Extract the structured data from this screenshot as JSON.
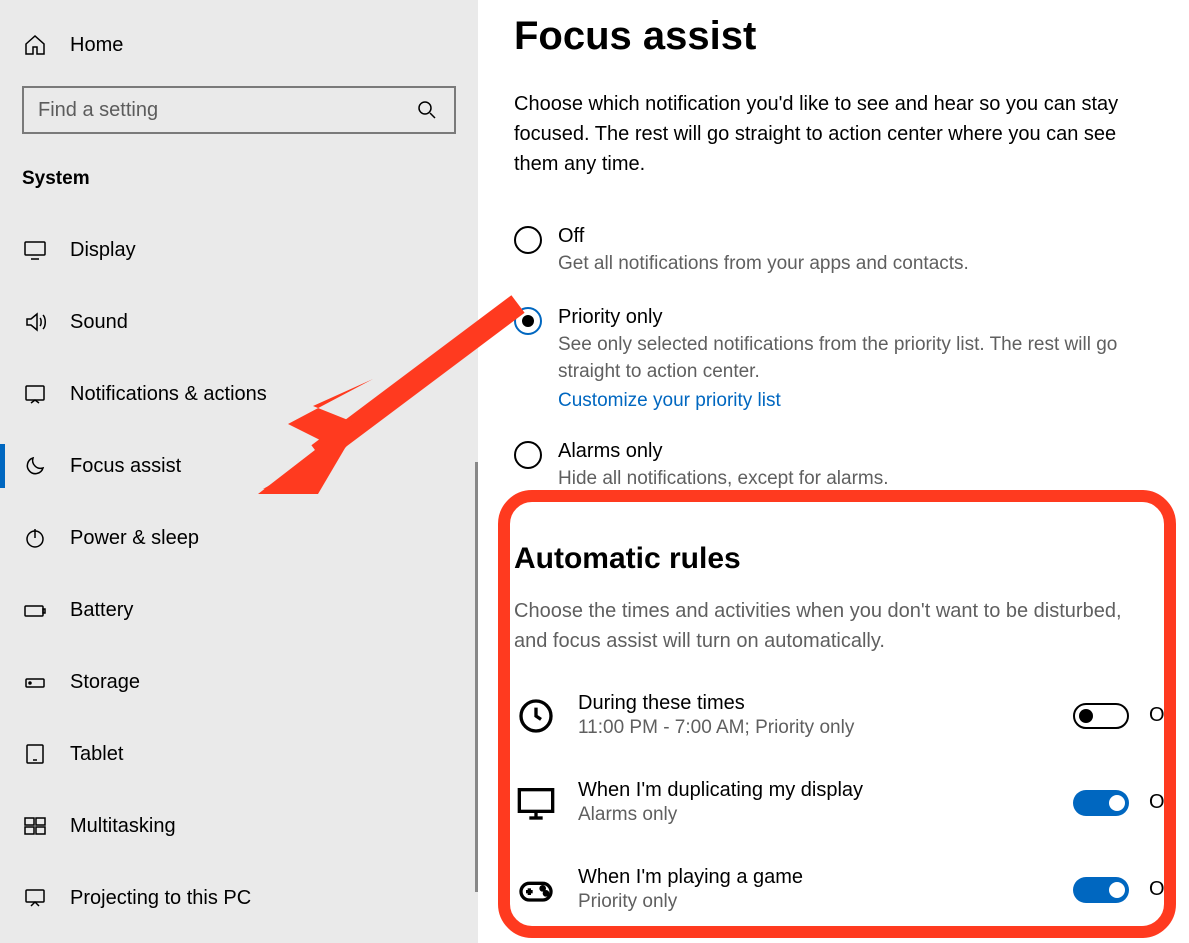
{
  "sidebar": {
    "home_label": "Home",
    "search_placeholder": "Find a setting",
    "category_label": "System",
    "items": [
      {
        "label": "Display"
      },
      {
        "label": "Sound"
      },
      {
        "label": "Notifications & actions"
      },
      {
        "label": "Focus assist"
      },
      {
        "label": "Power & sleep"
      },
      {
        "label": "Battery"
      },
      {
        "label": "Storage"
      },
      {
        "label": "Tablet"
      },
      {
        "label": "Multitasking"
      },
      {
        "label": "Projecting to this PC"
      }
    ]
  },
  "main": {
    "title": "Focus assist",
    "description": "Choose which notification you'd like to see and hear so you can stay focused. The rest will go straight to action center where you can see them any time.",
    "options": {
      "off": {
        "label": "Off",
        "sub": "Get all notifications from your apps and contacts."
      },
      "priority": {
        "label": "Priority only",
        "sub": "See only selected notifications from the priority list. The rest will go straight to action center.",
        "link": "Customize your priority list"
      },
      "alarms": {
        "label": "Alarms only",
        "sub": "Hide all notifications, except for alarms."
      }
    },
    "rules_title": "Automatic rules",
    "rules_desc": "Choose the times and activities when you don't want to be disturbed, and focus assist will turn on automatically.",
    "rules": [
      {
        "title": "During these times",
        "sub": "11:00 PM - 7:00 AM; Priority only",
        "state": "Off"
      },
      {
        "title": "When I'm duplicating my display",
        "sub": "Alarms only",
        "state": "On"
      },
      {
        "title": "When I'm playing a game",
        "sub": "Priority only",
        "state": "On"
      }
    ]
  }
}
